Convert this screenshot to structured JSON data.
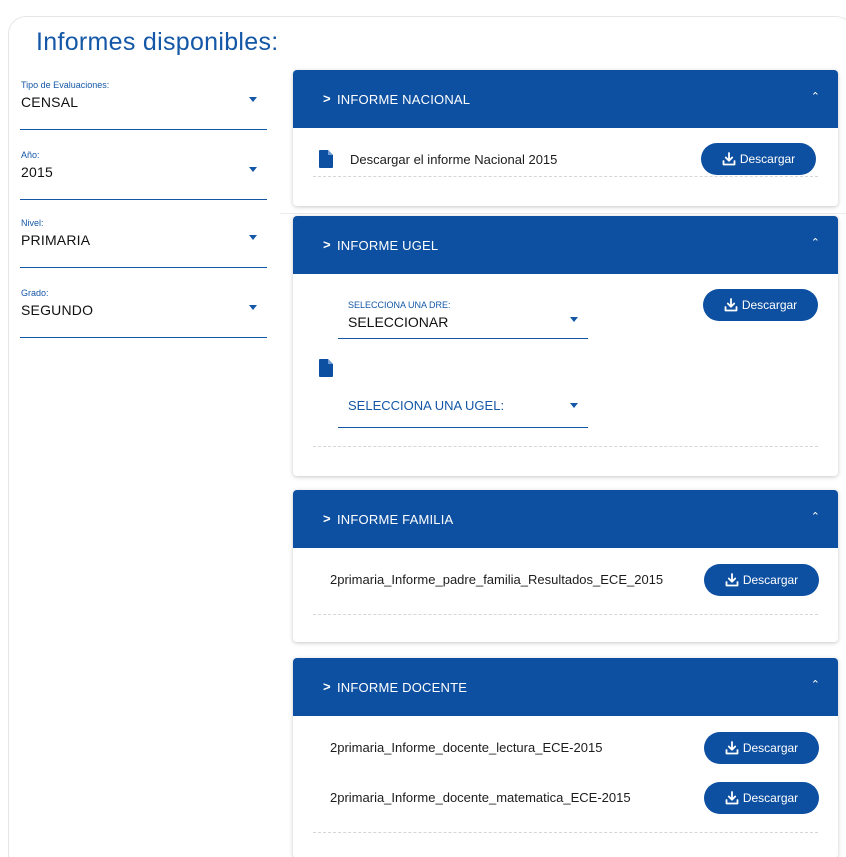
{
  "page": {
    "title": "Informes disponibles:"
  },
  "filters": [
    {
      "label": "Tipo de Evaluaciones:",
      "value": "CENSAL"
    },
    {
      "label": "Año:",
      "value": "2015"
    },
    {
      "label": "Nivel:",
      "value": "PRIMARIA"
    },
    {
      "label": "Grado:",
      "value": "SEGUNDO"
    }
  ],
  "download_label": "Descargar",
  "icons": {
    "chevron": "chevron-right-icon",
    "collapse": "chevron-up-icon",
    "download": "download-icon",
    "document": "document-icon"
  },
  "colors": {
    "primary": "#0d4fa0",
    "label": "#1457a6"
  },
  "cards": {
    "nacional": {
      "title": "INFORME NACIONAL",
      "row_text": "Descargar el informe Nacional 2015"
    },
    "ugel": {
      "title": "INFORME UGEL",
      "dre_label": "SELECCIONA UNA DRE:",
      "dre_value": "SELECCIONAR",
      "ugel_value": "SELECCIONA UNA UGEL:"
    },
    "familia": {
      "title": "INFORME FAMILIA",
      "row_text": "2primaria_Informe_padre_familia_Resultados_ECE_2015"
    },
    "docente": {
      "title": "INFORME DOCENTE",
      "rows": [
        "2primaria_Informe_docente_lectura_ECE-2015",
        "2primaria_Informe_docente_matematica_ECE-2015"
      ]
    }
  }
}
